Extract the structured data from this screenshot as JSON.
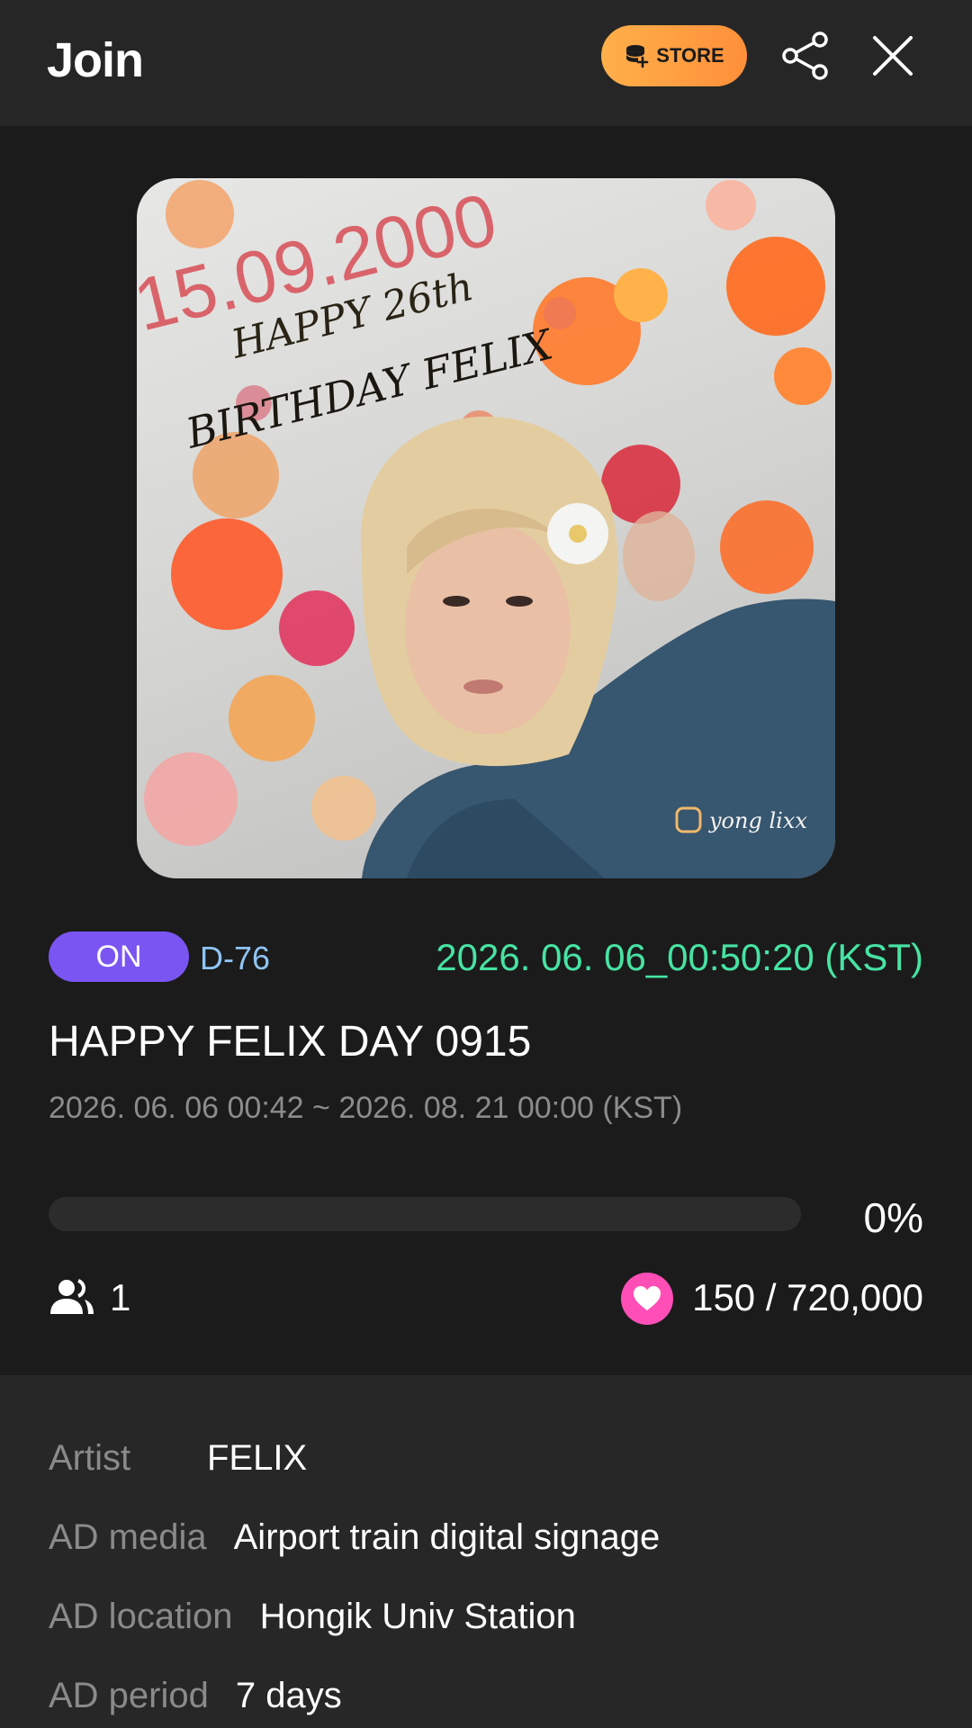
{
  "header": {
    "title": "Join",
    "store_label": "STORE"
  },
  "poster": {
    "date_text": "15.09.2000",
    "greeting_line1": "HAPPY 26th",
    "greeting_line2": "BIRTHDAY FELIX",
    "watermark": "yong lixx"
  },
  "status": {
    "badge": "ON",
    "dday": "D-76",
    "countdown": "2026. 06. 06_00:50:20 (KST)"
  },
  "event": {
    "title": "HAPPY FELIX DAY 0915",
    "period": "2026. 06. 06 00:42 ~ 2026. 08. 21 00:00 (KST)"
  },
  "progress": {
    "percent_value": 0,
    "percent_label": "0%"
  },
  "stats": {
    "participants": "1",
    "hearts": "150 / 720,000"
  },
  "details": {
    "artist_label": "Artist",
    "artist_value": "FELIX",
    "media_label": "AD media",
    "media_value": "Airport train digital signage",
    "location_label": "AD location",
    "location_value": "Hongik Univ Station",
    "period_label": "AD period",
    "period_value": "7 days"
  },
  "colors": {
    "accent_purple": "#7a55f2",
    "countdown_green": "#47e3a3",
    "dday_blue": "#8fc4f5",
    "heart_pink": "#ff4fb6",
    "store_orange": "#ff9a3e"
  },
  "icons": {
    "store": "coin-stack-icon",
    "share": "share-icon",
    "close": "close-icon",
    "participants": "people-icon",
    "hearts": "heart-icon"
  }
}
